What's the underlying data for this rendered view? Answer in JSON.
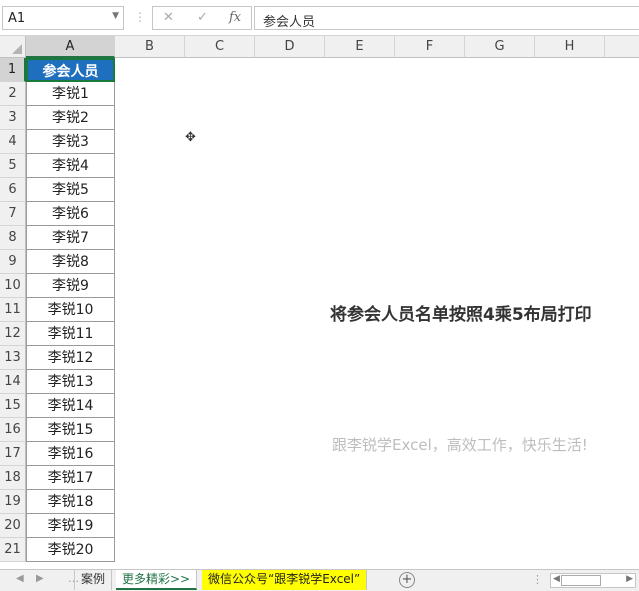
{
  "formula_bar": {
    "name_box": "A1",
    "cancel_glyph": "✕",
    "enter_glyph": "✓",
    "fx_label": "fx",
    "content": "参会人员"
  },
  "columns": [
    "A",
    "B",
    "C",
    "D",
    "E",
    "F",
    "G",
    "H"
  ],
  "rows": [
    "1",
    "2",
    "3",
    "4",
    "5",
    "6",
    "7",
    "8",
    "9",
    "10",
    "11",
    "12",
    "13",
    "14",
    "15",
    "16",
    "17",
    "18",
    "19",
    "20",
    "21"
  ],
  "column_a": [
    "参会人员",
    "李锐1",
    "李锐2",
    "李锐3",
    "李锐4",
    "李锐5",
    "李锐6",
    "李锐7",
    "李锐8",
    "李锐9",
    "李锐10",
    "李锐11",
    "李锐12",
    "李锐13",
    "李锐14",
    "李锐15",
    "李锐16",
    "李锐17",
    "李锐18",
    "李锐19",
    "李锐20"
  ],
  "header_fill": "#1f6fbf",
  "message_main": "将参会人员名单按照4乘5布局打印",
  "message_sub": "跟李锐学Excel，高效工作，快乐生活!",
  "sheet_tabs": [
    {
      "label": "案例"
    },
    {
      "label": "更多精彩>>"
    },
    {
      "label": "微信公众号“跟李锐学Excel”"
    }
  ],
  "add_sheet_glyph": "+",
  "accent_color": "#217346"
}
